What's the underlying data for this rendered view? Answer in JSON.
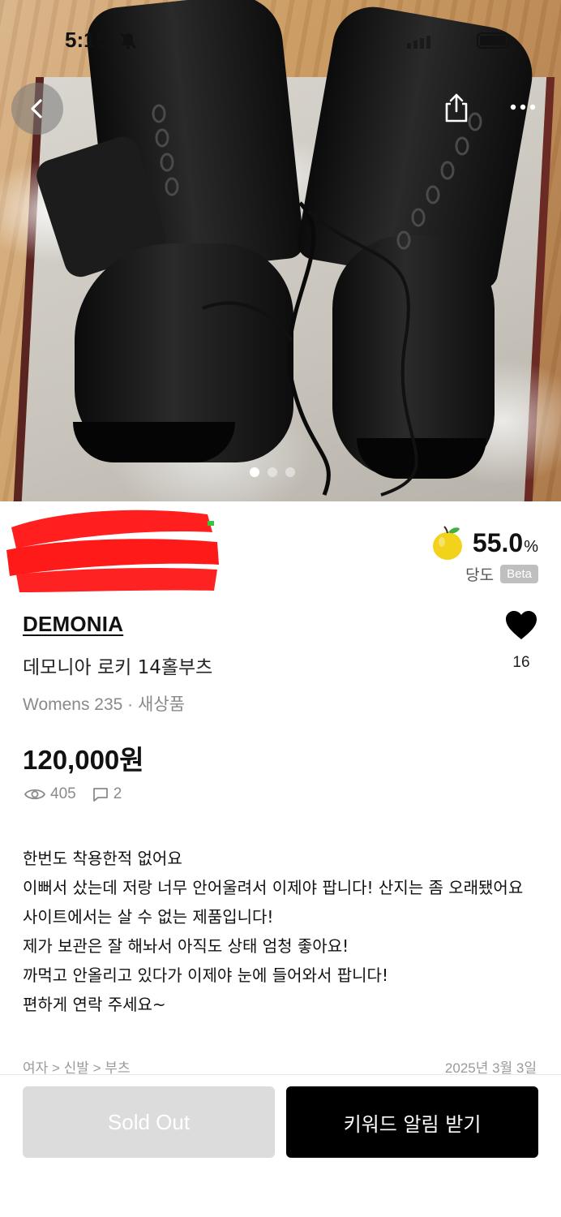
{
  "status_bar": {
    "time": "5:15"
  },
  "gallery": {
    "total_images": 3,
    "active_index": 0
  },
  "sweetness": {
    "value": "55.0",
    "unit": "%",
    "label": "당도",
    "badge": "Beta"
  },
  "product": {
    "brand": "DEMONIA",
    "title": "데모니아 로키 14홀부츠",
    "meta": "Womens 235 · 새상품",
    "price": "120,000원",
    "likes": "16",
    "views": "405",
    "comments": "2"
  },
  "description": [
    "한번도 착용한적 없어요",
    "이뻐서 샀는데 저랑 너무 안어울려서 이제야 팝니다! 산지는 좀 오래됐어요 사이트에서는 살 수 없는 제품입니다!",
    "제가 보관은 잘 해놔서 아직도 상태 엄청 좋아요!",
    "까먹고 안올리고 있다가 이제야 눈에 들어와서 팝니다!",
    "편하게 연락 주세요~"
  ],
  "category_path": "여자 > 신발 > 부츠",
  "posted_date": "2025년 3월 3일",
  "buttons": {
    "sold_out": "Sold Out",
    "keyword_alert": "키워드 알림 받기"
  },
  "icons": [
    "back-icon",
    "share-icon",
    "more-icon",
    "bell-muted-icon",
    "apple-icon",
    "heart-icon",
    "eye-icon",
    "comment-icon"
  ],
  "colors": {
    "primary_button": "#000000",
    "disabled_button": "#dcdcdc",
    "apple": "#f2d21b",
    "redaction": "#ff1a1a"
  }
}
